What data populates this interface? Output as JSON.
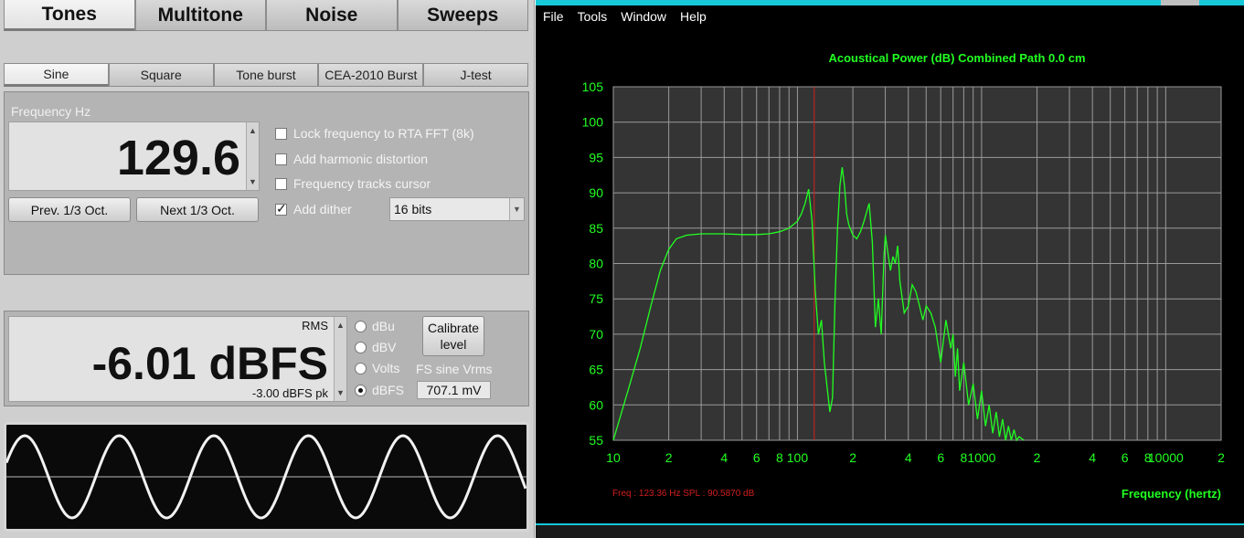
{
  "tabs": [
    "Tones",
    "Multitone",
    "Noise",
    "Sweeps"
  ],
  "active_tab": "Tones",
  "subtabs": [
    "Sine",
    "Square",
    "Tone burst",
    "CEA-2010 Burst",
    "J-test"
  ],
  "active_subtab": "Sine",
  "frequency": {
    "label": "Frequency Hz",
    "value": "129.6",
    "prev_button": "Prev. 1/3 Oct.",
    "next_button": "Next 1/3 Oct."
  },
  "options": [
    {
      "label": "Lock frequency to RTA FFT (8k)",
      "checked": false
    },
    {
      "label": "Add harmonic distortion",
      "checked": false
    },
    {
      "label": "Frequency tracks cursor",
      "checked": false
    },
    {
      "label": "Add dither",
      "checked": true
    }
  ],
  "dither_select": "16 bits",
  "level": {
    "rms_label": "RMS",
    "value": "-6.01 dBFS",
    "peak": "-3.00 dBFS pk",
    "units": [
      {
        "label": "dBu",
        "selected": false
      },
      {
        "label": "dBV",
        "selected": false
      },
      {
        "label": "Volts",
        "selected": false
      },
      {
        "label": "dBFS",
        "selected": true
      }
    ],
    "calibrate_button": "Calibrate level",
    "fs_label": "FS sine Vrms",
    "fs_value": "707.1 mV"
  },
  "scope": {
    "cycles": 5.5
  },
  "menu": [
    "File",
    "Tools",
    "Window",
    "Help"
  ],
  "chart_data": {
    "type": "line",
    "title": "Acoustical Power (dB)   Combined   Path 0.0 cm",
    "xlabel": "Frequency (hertz)",
    "ylabel": "",
    "x_scale": "log",
    "xlim": [
      10,
      20000
    ],
    "ylim": [
      55,
      105
    ],
    "yticks": [
      55,
      60,
      65,
      70,
      75,
      80,
      85,
      90,
      95,
      100,
      105
    ],
    "xtick_labels": [
      {
        "f": 10,
        "label": "10"
      },
      {
        "f": 20,
        "label": "2"
      },
      {
        "f": 40,
        "label": "4"
      },
      {
        "f": 60,
        "label": "6"
      },
      {
        "f": 80,
        "label": "8"
      },
      {
        "f": 100,
        "label": "100"
      },
      {
        "f": 200,
        "label": "2"
      },
      {
        "f": 400,
        "label": "4"
      },
      {
        "f": 600,
        "label": "6"
      },
      {
        "f": 800,
        "label": "8"
      },
      {
        "f": 1000,
        "label": "1000"
      },
      {
        "f": 2000,
        "label": "2"
      },
      {
        "f": 4000,
        "label": "4"
      },
      {
        "f": 6000,
        "label": "6"
      },
      {
        "f": 8000,
        "label": "8"
      },
      {
        "f": 10000,
        "label": "10000"
      },
      {
        "f": 20000,
        "label": "2"
      }
    ],
    "grid": true,
    "cursor_x": 123.36,
    "readout": "Freq : 123.36 Hz      SPL : 90.5870 dB",
    "colors": {
      "trace": "#22ff22",
      "grid": "#9a9a9a",
      "plot_bg": "#343434",
      "cursor": "#d21e1e",
      "readout": "#d21e1e",
      "text": "#22ff22"
    },
    "series": [
      {
        "x": [
          10,
          12,
          14,
          16,
          18,
          20,
          22,
          25,
          30,
          40,
          50,
          60,
          70,
          80,
          90,
          100,
          105,
          110,
          115,
          120,
          125,
          130,
          135,
          140,
          150,
          155,
          160,
          165,
          170,
          175,
          180,
          185,
          190,
          200,
          210,
          220,
          230,
          245,
          255,
          265,
          275,
          285,
          295,
          300,
          310,
          320,
          330,
          340,
          350,
          360,
          380,
          400,
          420,
          440,
          460,
          480,
          500,
          530,
          560,
          600,
          640,
          680,
          700,
          720,
          740,
          760,
          800,
          850,
          900,
          950,
          1000,
          1050,
          1100,
          1150,
          1200,
          1250,
          1300,
          1350,
          1400,
          1450,
          1500,
          1550,
          1600,
          1700
        ],
        "y": [
          55,
          62,
          68,
          74,
          79,
          82,
          83.5,
          84,
          84.2,
          84.2,
          84.1,
          84.1,
          84.2,
          84.5,
          85,
          86,
          87,
          88.5,
          90.5,
          86,
          76,
          70,
          72,
          66,
          59,
          61,
          75,
          85,
          91,
          93.6,
          91,
          87,
          85.5,
          84,
          83.5,
          84.5,
          86,
          88.5,
          83,
          71,
          75,
          70,
          81,
          84,
          81.5,
          79,
          81,
          80,
          82.5,
          77.5,
          73,
          74,
          77,
          76,
          74,
          72,
          74,
          73,
          71,
          66,
          72,
          68,
          70,
          64,
          68,
          62,
          66,
          60,
          63,
          58,
          62,
          57,
          60,
          56,
          59,
          55.5,
          58,
          55,
          57,
          55,
          56.5,
          55,
          55.5,
          55
        ]
      }
    ]
  }
}
